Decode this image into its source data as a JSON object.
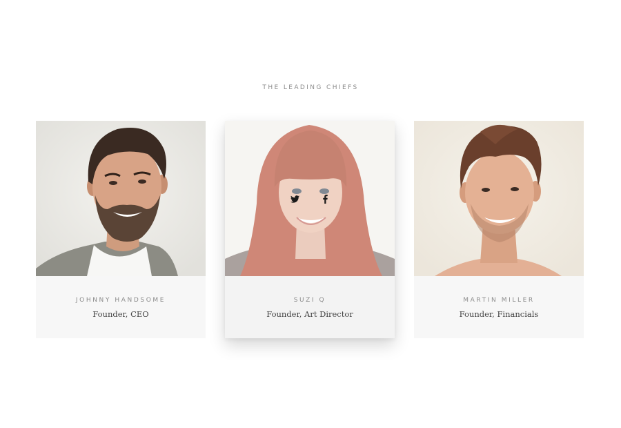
{
  "section": {
    "title": "THE LEADING CHIEFS"
  },
  "team": [
    {
      "name": "JOHNNY HANDSOME",
      "role": "Founder, CEO"
    },
    {
      "name": "SUZI Q",
      "role": "Founder, Art Director",
      "social": [
        "twitter-icon",
        "facebook-icon"
      ]
    },
    {
      "name": "MARTIN MILLER",
      "role": "Founder, Financials"
    }
  ],
  "colors": {
    "card_background": "#f7f7f7",
    "title_text": "#8c8c8c",
    "role_text": "#444444"
  }
}
